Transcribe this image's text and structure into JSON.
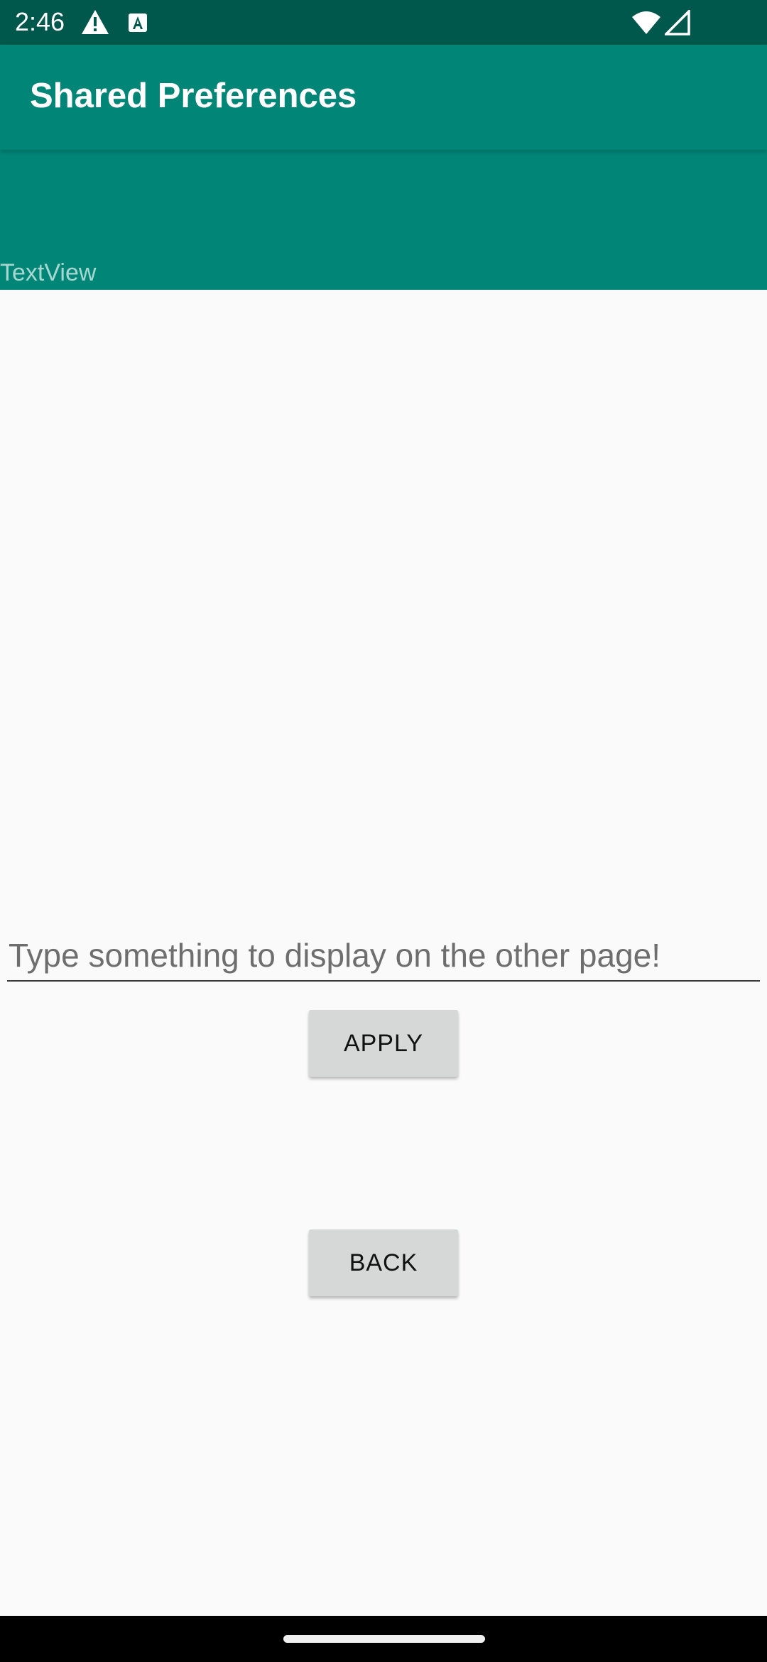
{
  "status_bar": {
    "time": "2:46",
    "icons": [
      "warning-icon",
      "a-square-icon",
      "wifi-icon",
      "signal-icon"
    ],
    "background_color": "#00574b"
  },
  "app_bar": {
    "title": "Shared Preferences",
    "background_color": "#008577"
  },
  "header_block": {
    "textview_text": "TextView"
  },
  "input": {
    "value": "",
    "placeholder": "Type something to display on the other page!"
  },
  "buttons": {
    "apply_label": "APPLY",
    "back_label": "BACK"
  },
  "colors": {
    "accent": "#008577",
    "status_bar": "#00574b",
    "button_bg": "#d6d7d7",
    "page_bg": "#fafafa"
  }
}
